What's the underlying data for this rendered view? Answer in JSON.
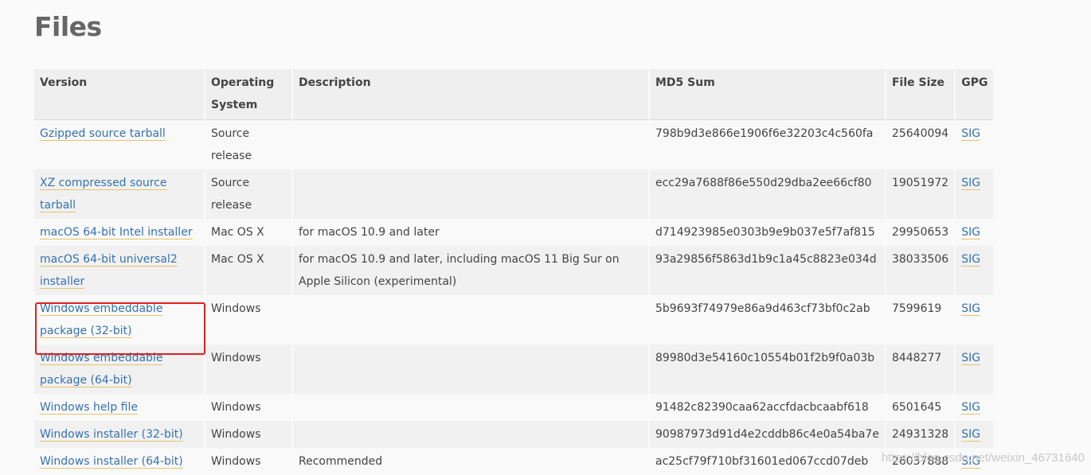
{
  "page": {
    "title": "Files"
  },
  "table": {
    "headers": [
      "Version",
      "Operating System",
      "Description",
      "MD5 Sum",
      "File Size",
      "GPG"
    ],
    "rows": [
      {
        "version": "Gzipped source tarball",
        "os": "Source release",
        "description": "",
        "md5": "798b9d3e866e1906f6e32203c4c560fa",
        "size": "25640094",
        "gpg": "SIG"
      },
      {
        "version": "XZ compressed source tarball",
        "os": "Source release",
        "description": "",
        "md5": "ecc29a7688f86e550d29dba2ee66cf80",
        "size": "19051972",
        "gpg": "SIG"
      },
      {
        "version": "macOS 64-bit Intel installer",
        "os": "Mac OS X",
        "description": "for macOS 10.9 and later",
        "md5": "d714923985e0303b9e9b037e5f7af815",
        "size": "29950653",
        "gpg": "SIG"
      },
      {
        "version": "macOS 64-bit universal2 installer",
        "os": "Mac OS X",
        "description": "for macOS 10.9 and later, including macOS 11 Big Sur on Apple Silicon (experimental)",
        "md5": "93a29856f5863d1b9c1a45c8823e034d",
        "size": "38033506",
        "gpg": "SIG"
      },
      {
        "version": "Windows embeddable package (32-bit)",
        "os": "Windows",
        "description": "",
        "md5": "5b9693f74979e86a9d463cf73bf0c2ab",
        "size": "7599619",
        "gpg": "SIG"
      },
      {
        "version": "Windows embeddable package (64-bit)",
        "os": "Windows",
        "description": "",
        "md5": "89980d3e54160c10554b01f2b9f0a03b",
        "size": "8448277",
        "gpg": "SIG"
      },
      {
        "version": "Windows help file",
        "os": "Windows",
        "description": "",
        "md5": "91482c82390caa62accfdacbcaabf618",
        "size": "6501645",
        "gpg": "SIG"
      },
      {
        "version": "Windows installer (32-bit)",
        "os": "Windows",
        "description": "",
        "md5": "90987973d91d4e2cddb86c4e0a54ba7e",
        "size": "24931328",
        "gpg": "SIG"
      },
      {
        "version": "Windows installer (64-bit)",
        "os": "Windows",
        "description": "Recommended",
        "md5": "ac25cf79f710bf31601ed067ccd07deb",
        "size": "26037888",
        "gpg": "SIG"
      }
    ]
  },
  "watermark": "https://blog.csdn.net/weixin_46731640",
  "colors": {
    "link": "#3572b0",
    "highlight": "#e02020"
  }
}
